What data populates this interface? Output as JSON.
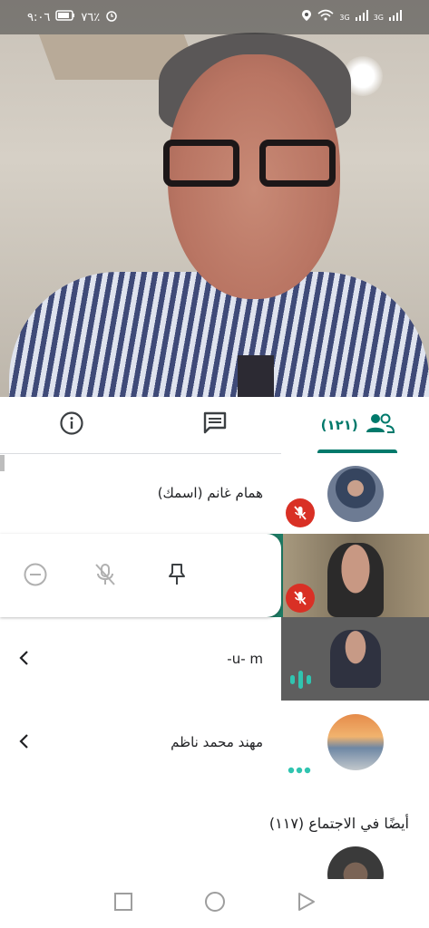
{
  "status_bar": {
    "time": "٩:٠٦",
    "battery": "٧٦٪",
    "signal1": "3G",
    "signal2": "3G"
  },
  "tabs": {
    "people_count": "(١٢١)"
  },
  "participants": [
    {
      "name": "همام غانم (اسمك)",
      "muted": true
    },
    {
      "name": "",
      "muted": true
    },
    {
      "name": "u- m-",
      "speaking": true
    },
    {
      "name": "مهند محمد ناظم",
      "more": true
    }
  ],
  "section": {
    "also_in_meeting": "أيضًا في الاجتماع (١١٧)"
  },
  "colors": {
    "accent": "#00796b",
    "mute_red": "#d93025",
    "close_green": "#1e7a63"
  }
}
